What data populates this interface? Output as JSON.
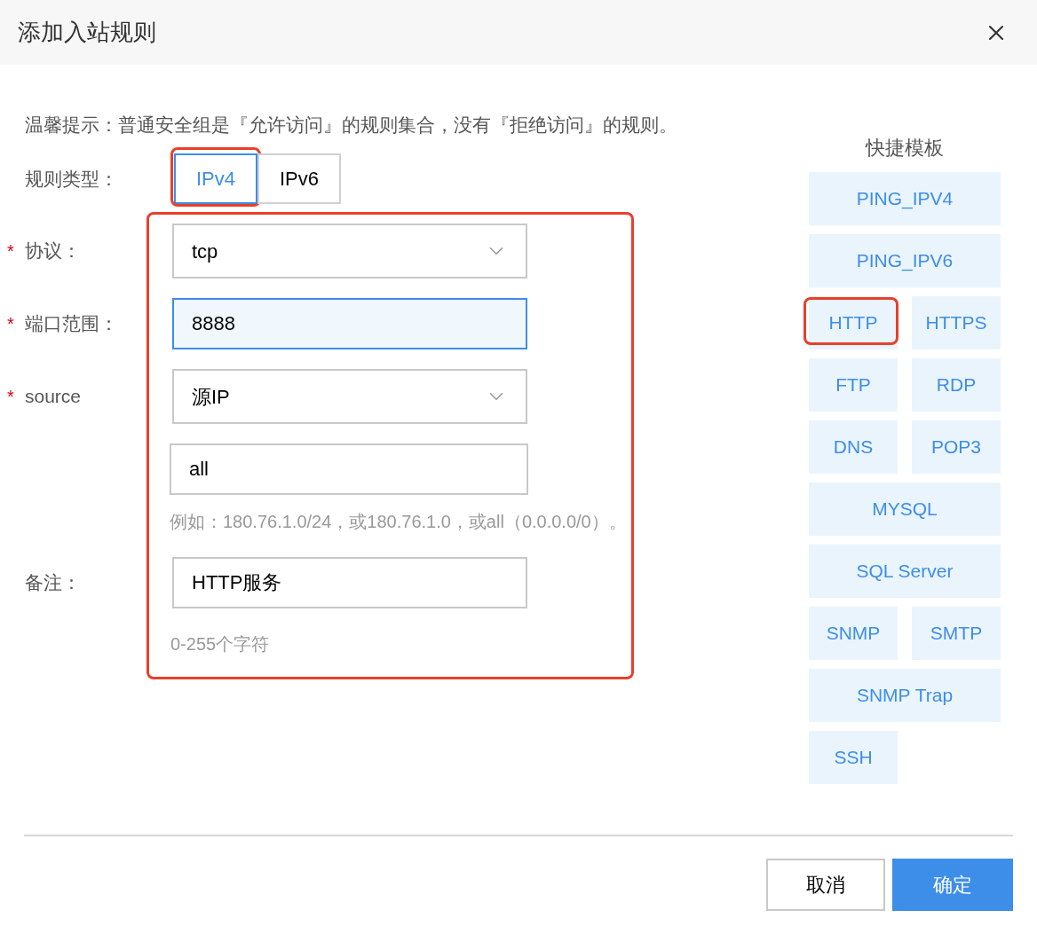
{
  "dialog": {
    "title": "添加入站规则",
    "hint": "温馨提示：普通安全组是『允许访问』的规则集合，没有『拒绝访问』的规则。",
    "rule_type": {
      "label": "规则类型：",
      "tabs": [
        {
          "label": "IPv4",
          "selected": true,
          "highlighted": true
        },
        {
          "label": "IPv6",
          "selected": false,
          "highlighted": false
        }
      ]
    },
    "form": {
      "highlighted": true,
      "fields": [
        {
          "kind": "select",
          "marker": "*",
          "label": "协议：",
          "value": "tcp",
          "focused": false
        },
        {
          "kind": "input",
          "marker": "*",
          "label": "端口范围：",
          "value": "8888",
          "focused": true
        },
        {
          "kind": "select",
          "marker": "*",
          "label": "source",
          "value": "源IP",
          "focused": false
        },
        {
          "kind": "input",
          "value": "all",
          "focused": false,
          "help": "例如：180.76.1.0/24，或180.76.1.0，或all（0.0.0.0/0）。"
        },
        {
          "kind": "input",
          "label": "备注：",
          "value": "HTTP服务",
          "focused": false,
          "help": "0-255个字符"
        }
      ]
    },
    "templates": {
      "title": "快捷模板",
      "items": [
        {
          "label": "PING_IPV4",
          "wide": true,
          "highlighted": false
        },
        {
          "label": "PING_IPV6",
          "wide": true,
          "highlighted": false
        },
        {
          "label": "HTTP",
          "wide": false,
          "highlighted": true
        },
        {
          "label": "HTTPS",
          "wide": false,
          "highlighted": false
        },
        {
          "label": "FTP",
          "wide": false,
          "highlighted": false
        },
        {
          "label": "RDP",
          "wide": false,
          "highlighted": false
        },
        {
          "label": "DNS",
          "wide": false,
          "highlighted": false
        },
        {
          "label": "POP3",
          "wide": false,
          "highlighted": false
        },
        {
          "label": "MYSQL",
          "wide": true,
          "highlighted": false
        },
        {
          "label": "SQL Server",
          "wide": true,
          "highlighted": false
        },
        {
          "label": "SNMP",
          "wide": false,
          "highlighted": false
        },
        {
          "label": "SMTP",
          "wide": false,
          "highlighted": false
        },
        {
          "label": "SNMP Trap",
          "wide": true,
          "highlighted": false
        },
        {
          "label": "SSH",
          "wide": false,
          "highlighted": false
        }
      ]
    },
    "buttons": [
      {
        "label": "取消",
        "primary": false
      },
      {
        "label": "确定",
        "primary": true
      }
    ]
  }
}
